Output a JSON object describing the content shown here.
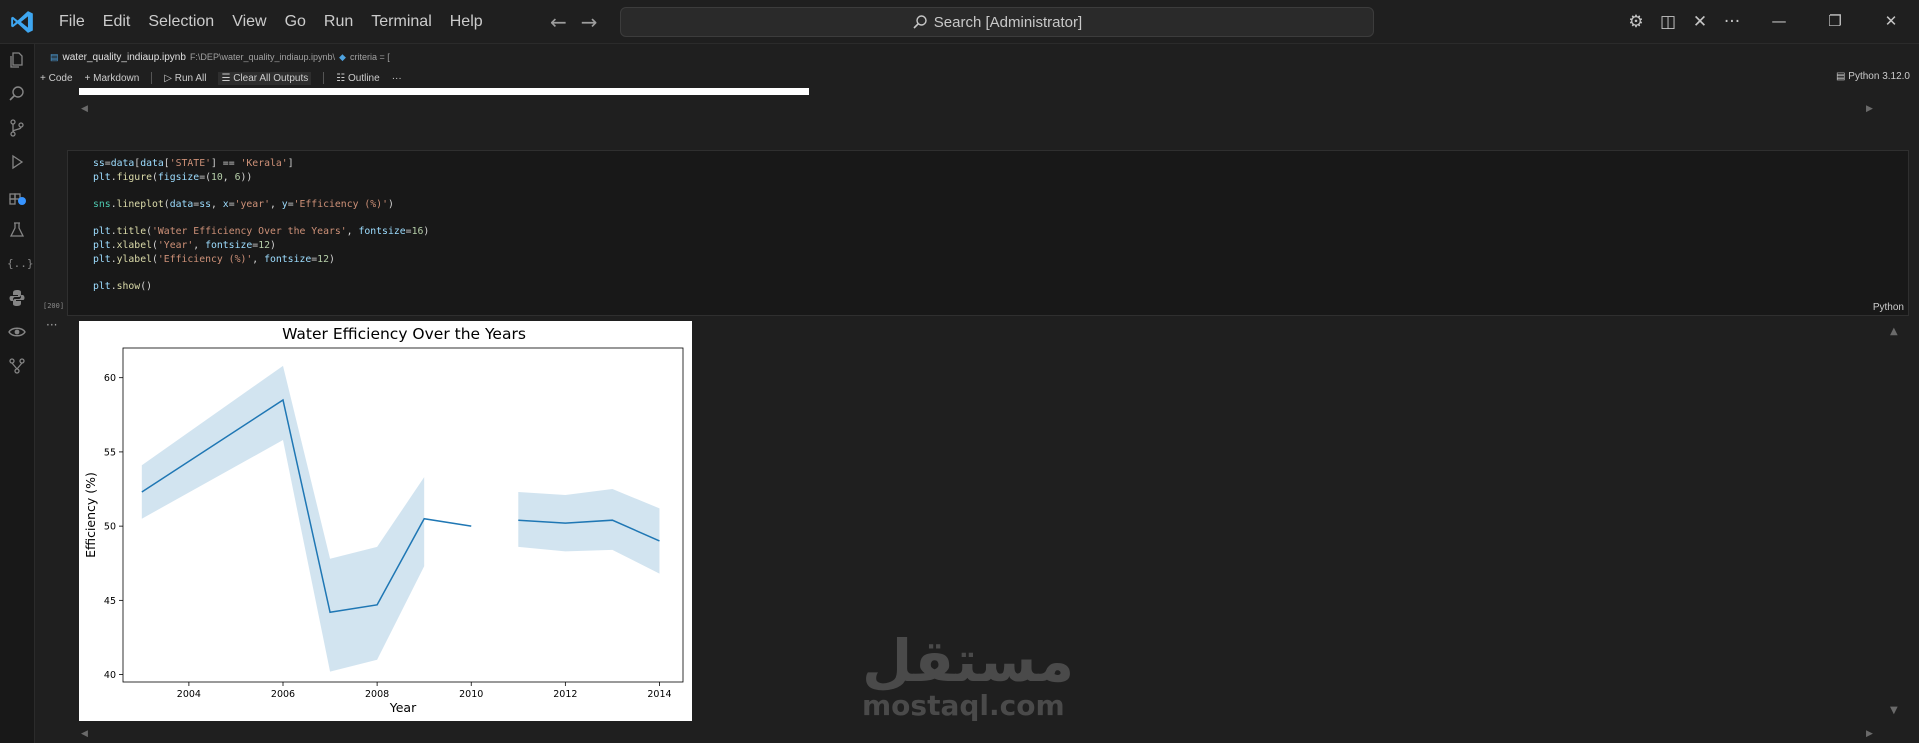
{
  "menu": [
    "File",
    "Edit",
    "Selection",
    "View",
    "Go",
    "Run",
    "Terminal",
    "Help"
  ],
  "search": {
    "label": "Search [Administrator]"
  },
  "breadcrumb": {
    "file": "water_quality_indiaup.ipynb",
    "path": "F:\\DEP\\water_quality_indiaup.ipynb\\",
    "symbol": "criteria = ["
  },
  "toolbar": {
    "code": "Code",
    "markdown": "Markdown",
    "run_all": "Run All",
    "clear_outputs": "Clear All Outputs",
    "outline": "Outline",
    "more": "···"
  },
  "kernel": "Python 3.12.0",
  "cell": {
    "exec_count": "[200]",
    "language": "Python",
    "lines": [
      "ss=data[data['STATE'] == 'Kerala']",
      "plt.figure(figsize=(10, 6))",
      "",
      "sns.lineplot(data=ss, x='year', y='Efficiency (%)')",
      "",
      "plt.title('Water Efficiency Over the Years', fontsize=16)",
      "plt.xlabel('Year', fontsize=12)",
      "plt.ylabel('Efficiency (%)', fontsize=12)",
      "",
      "plt.show()"
    ]
  },
  "chart_data": {
    "type": "line",
    "title": "Water Efficiency Over the Years",
    "xlabel": "Year",
    "ylabel": "Efficiency (%)",
    "xlim": [
      2002.6,
      2014.5
    ],
    "ylim": [
      39.5,
      62.0
    ],
    "xticks": [
      2004,
      2006,
      2008,
      2010,
      2012,
      2014
    ],
    "yticks": [
      40,
      45,
      50,
      55,
      60
    ],
    "grid": false,
    "line_color": "#1f77b4",
    "band_color": "#1f77b4",
    "segments": [
      {
        "x": [
          2003,
          2006,
          2007,
          2008,
          2009,
          2010
        ],
        "y": [
          52.3,
          58.5,
          44.2,
          44.7,
          50.5,
          50.0
        ]
      },
      {
        "x": [
          2011,
          2012,
          2013,
          2014
        ],
        "y": [
          50.4,
          50.2,
          50.4,
          49.0
        ]
      }
    ],
    "confidence_bands": [
      {
        "x": [
          2003,
          2006,
          2007,
          2008,
          2009
        ],
        "upper": [
          54.1,
          60.8,
          47.8,
          48.6,
          53.3
        ],
        "lower": [
          50.5,
          55.8,
          40.2,
          41.0,
          47.3
        ]
      },
      {
        "x": [
          2011,
          2012,
          2013,
          2014
        ],
        "upper": [
          52.3,
          52.1,
          52.5,
          51.2
        ],
        "lower": [
          48.6,
          48.3,
          48.4,
          46.8
        ]
      }
    ]
  },
  "watermark": {
    "arabic": "مستقل",
    "latin": "mostaql.com"
  }
}
